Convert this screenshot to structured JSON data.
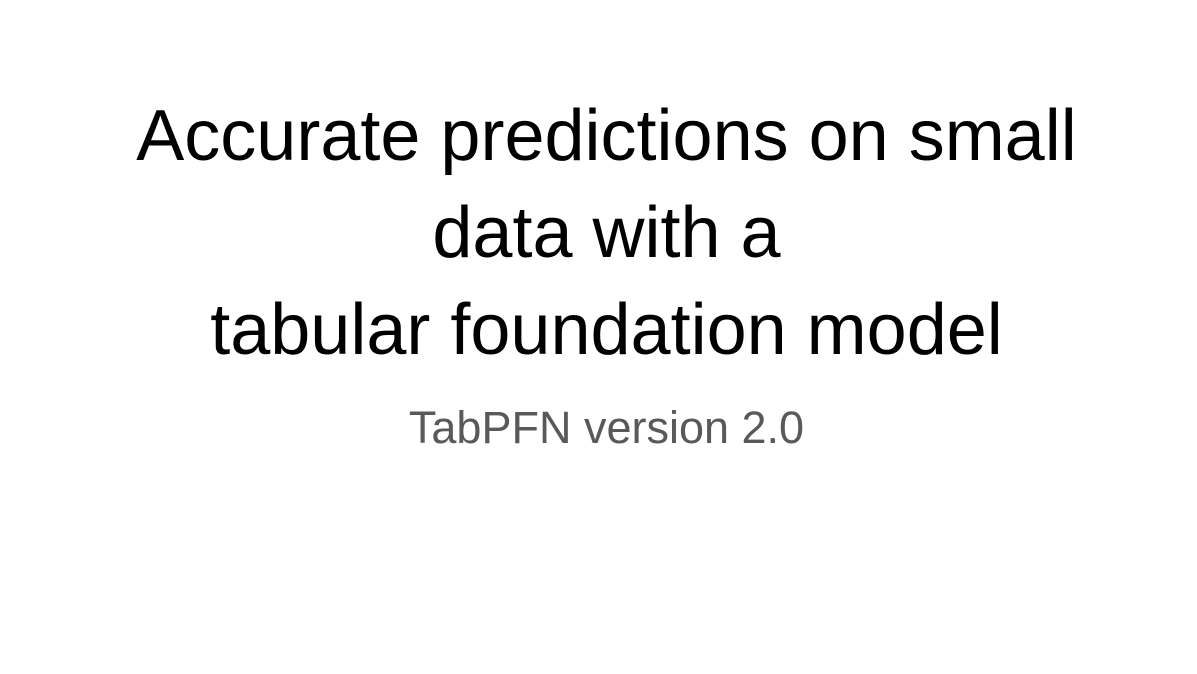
{
  "slide": {
    "title_lines": [
      "Accurate predictions on small",
      "data with a",
      "tabular foundation model"
    ],
    "subtitle": "TabPFN version 2.0",
    "colors": {
      "background": "#ffffff",
      "title": "#000000",
      "subtitle": "#595959"
    }
  }
}
